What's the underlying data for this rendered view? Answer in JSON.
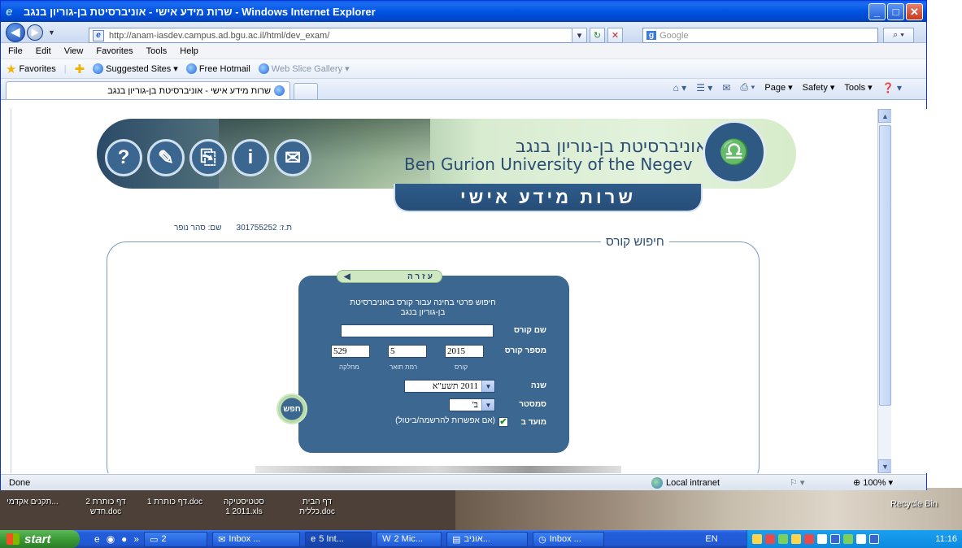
{
  "window": {
    "title": "שרות מידע אישי - אוניברסיטת בן-גוריון בנגב - Windows Internet Explorer",
    "controls": [
      "minimize",
      "maximize",
      "close"
    ]
  },
  "address": {
    "url": "http://anam-iasdev.campus.ad.bgu.ac.il/html/dev_exam/",
    "search_placeholder": "Google"
  },
  "menu": [
    "File",
    "Edit",
    "View",
    "Favorites",
    "Tools",
    "Help"
  ],
  "favorites": {
    "label": "Favorites",
    "items": [
      {
        "label": "Suggested Sites ▾",
        "dim": false
      },
      {
        "label": "Free Hotmail",
        "dim": false
      },
      {
        "label": "Web Slice Gallery ▾",
        "dim": true
      }
    ]
  },
  "tab": {
    "title": "שרות מידע אישי - אוניברסיטת בן-גוריון בנגב"
  },
  "commands": [
    "Page ▾",
    "Safety ▾",
    "Tools ▾"
  ],
  "banner": {
    "hebrew_name": "אוניברסיטת בן-גוריון בנגב",
    "english_name": "Ben Gurion University of the Negev",
    "service_title": "שרות מידע אישי",
    "icons": [
      "?",
      "✎",
      "⎘",
      "i",
      "✉"
    ]
  },
  "student": {
    "id_label": "ת.ז:",
    "id_value": "301755252",
    "name_label": "שם:",
    "name_value": "סהר נופר"
  },
  "search_frame": {
    "title": "חיפוש קורס",
    "help_label": "עזרה",
    "intro": "חיפוש פרטי בחינה עבור קורס באוניברסיטת בן-גוריון בנגב",
    "course_name_label": "שם קורס",
    "course_name_value": "",
    "course_number_label": "מספר קורס",
    "dept_value": "529",
    "degree_value": "5",
    "course_value": "2015",
    "dept_sub": "מחלקה",
    "degree_sub": "רמת תואר",
    "course_sub": "קורס",
    "year_label": "שנה",
    "year_value": "2011 תשע\"א",
    "semester_label": "סמסטר",
    "semester_value": "ב'",
    "moed_label": "מועד ב",
    "moed_checked": "✔",
    "moed_note": "(אם אפשרות להרשמה/ביטול)",
    "search_button": "חפש"
  },
  "status": {
    "text": "Done",
    "zone": "Local intranet",
    "zoom": "100%"
  },
  "desktop": {
    "icons": [
      {
        "label": "תקנים אקדמי..."
      },
      {
        "label": "דף כותרת 2 חדש.doc"
      },
      {
        "label": "דף כותרת 1.doc"
      },
      {
        "label": "סטטיסטיקה 2011 1.xls"
      },
      {
        "label": "דף הבית כללית.doc"
      }
    ],
    "recycle_bin": "Recycle Bin"
  },
  "taskbar": {
    "start": "start",
    "tasks": [
      {
        "label": "2",
        "active": false
      },
      {
        "label": "Inbox ...",
        "active": false
      },
      {
        "label": "5 Int...",
        "active": true
      },
      {
        "label": "2 Mic...",
        "active": false
      },
      {
        "label": "אוניב...",
        "active": false
      },
      {
        "label": "Inbox ...",
        "active": false
      }
    ],
    "lang": "EN",
    "clock": "11:16"
  }
}
